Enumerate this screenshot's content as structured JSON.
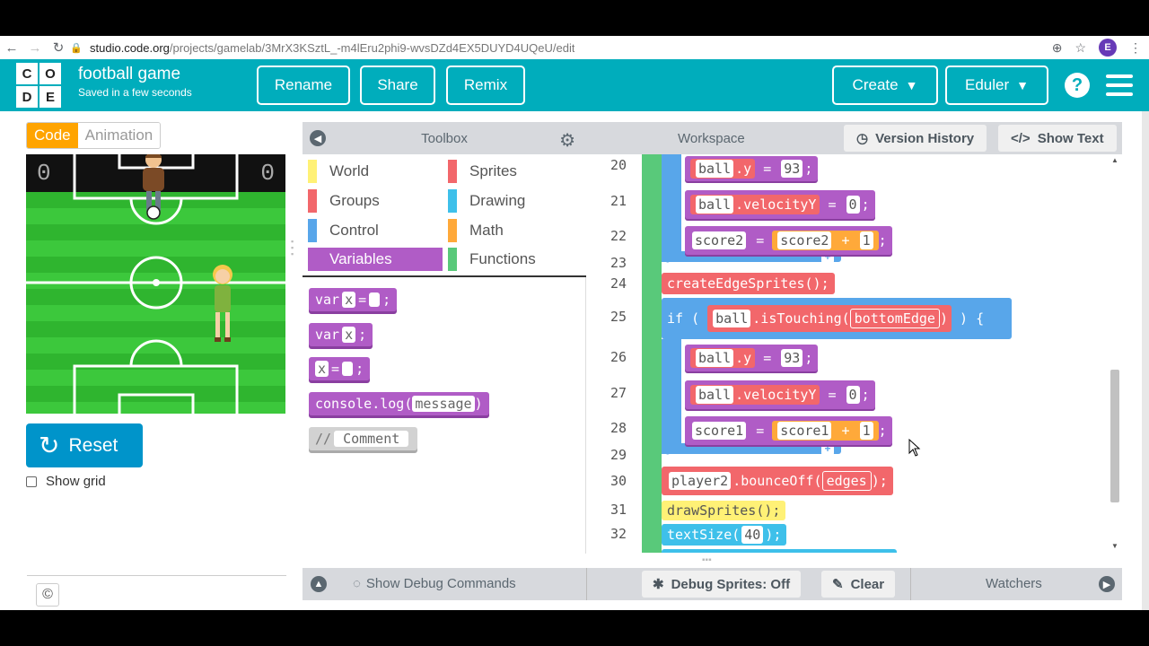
{
  "browser": {
    "url_host": "studio.code.org",
    "url_path": "/projects/gamelab/3MrX3KSztL_-m4lEru2phi9-wvsDZd4EX5DUYD4UQeU/edit",
    "avatar_letter": "E"
  },
  "header": {
    "logo_letters": [
      "C",
      "O",
      "D",
      "E"
    ],
    "project_title": "football game",
    "save_status": "Saved in a few seconds",
    "rename_label": "Rename",
    "share_label": "Share",
    "remix_label": "Remix",
    "create_label": "Create",
    "user_label": "Eduler",
    "help_label": "?"
  },
  "left": {
    "code_tab": "Code",
    "animation_tab": "Animation",
    "score_left": "0",
    "score_right": "0",
    "reset_label": "Reset",
    "show_grid_label": "Show grid",
    "copyright": "©"
  },
  "toolbox": {
    "title": "Toolbox",
    "categories": [
      {
        "label": "World",
        "color": "#fff176"
      },
      {
        "label": "Sprites",
        "color": "#f2676b"
      },
      {
        "label": "Groups",
        "color": "#f2676b"
      },
      {
        "label": "Drawing",
        "color": "#3ec0ea"
      },
      {
        "label": "Control",
        "color": "#58a6ea"
      },
      {
        "label": "Math",
        "color": "#ffa93a"
      },
      {
        "label": "Variables",
        "color": "#b05cc6"
      },
      {
        "label": "Functions",
        "color": "#59c97a"
      }
    ],
    "blocks": {
      "b1_kw": "var",
      "b1_name": "x",
      "b1_eq": "=",
      "b1_end": ";",
      "b2_kw": "var",
      "b2_name": "x",
      "b2_end": ";",
      "b3_name": "x",
      "b3_eq": "=",
      "b3_end": ";",
      "b4_fn": "console.log(",
      "b4_arg": "message",
      "b4_end": ")",
      "b5_kw": "//",
      "b5_text": "Comment"
    }
  },
  "workspace": {
    "title": "Workspace",
    "version_history": "Version History",
    "show_text": "Show Text",
    "line_numbers": [
      "20",
      "21",
      "22",
      "23",
      "24",
      "25",
      "26",
      "27",
      "28",
      "29",
      "30",
      "31",
      "32"
    ],
    "code": {
      "l20_obj": "ball",
      "l20_prop": ".y",
      "l20_eq": "=",
      "l20_val": "93",
      "l20_end": ";",
      "l21_obj": "ball",
      "l21_prop": ".velocityY",
      "l21_eq": "=",
      "l21_val": "0",
      "l21_end": ";",
      "l22_var": "score2",
      "l22_eq": "=",
      "l22_op_var": "score2",
      "l22_op": "+",
      "l22_val": "1",
      "l22_end": ";",
      "l24_text": "createEdgeSprites();",
      "l25_if": "if",
      "l25_paren_open": "(",
      "l25_obj": "ball",
      "l25_fn": ".isTouching(",
      "l25_arg": "bottomEdge",
      "l25_close": ")",
      "l25_paren_close": ")",
      "l25_brace": "{",
      "l26_obj": "ball",
      "l26_prop": ".y",
      "l26_eq": "=",
      "l26_val": "93",
      "l26_end": ";",
      "l27_obj": "ball",
      "l27_prop": ".velocityY",
      "l27_eq": "=",
      "l27_val": "0",
      "l27_end": ";",
      "l28_var": "score1",
      "l28_eq": "=",
      "l28_op_var": "score1",
      "l28_op": "+",
      "l28_val": "1",
      "l28_end": ";",
      "l30_obj": "player2",
      "l30_fn": ".bounceOff(",
      "l30_arg": "edges",
      "l30_end": ");",
      "l31_text": "drawSprites();",
      "l32_fn": "textSize(",
      "l32_val": "40",
      "l32_end": ");",
      "brace_close": "}",
      "plus": "+"
    }
  },
  "bottom": {
    "show_debug": "Show Debug Commands",
    "debug_sprites": "Debug Sprites: Off",
    "clear": "Clear",
    "watchers": "Watchers"
  }
}
